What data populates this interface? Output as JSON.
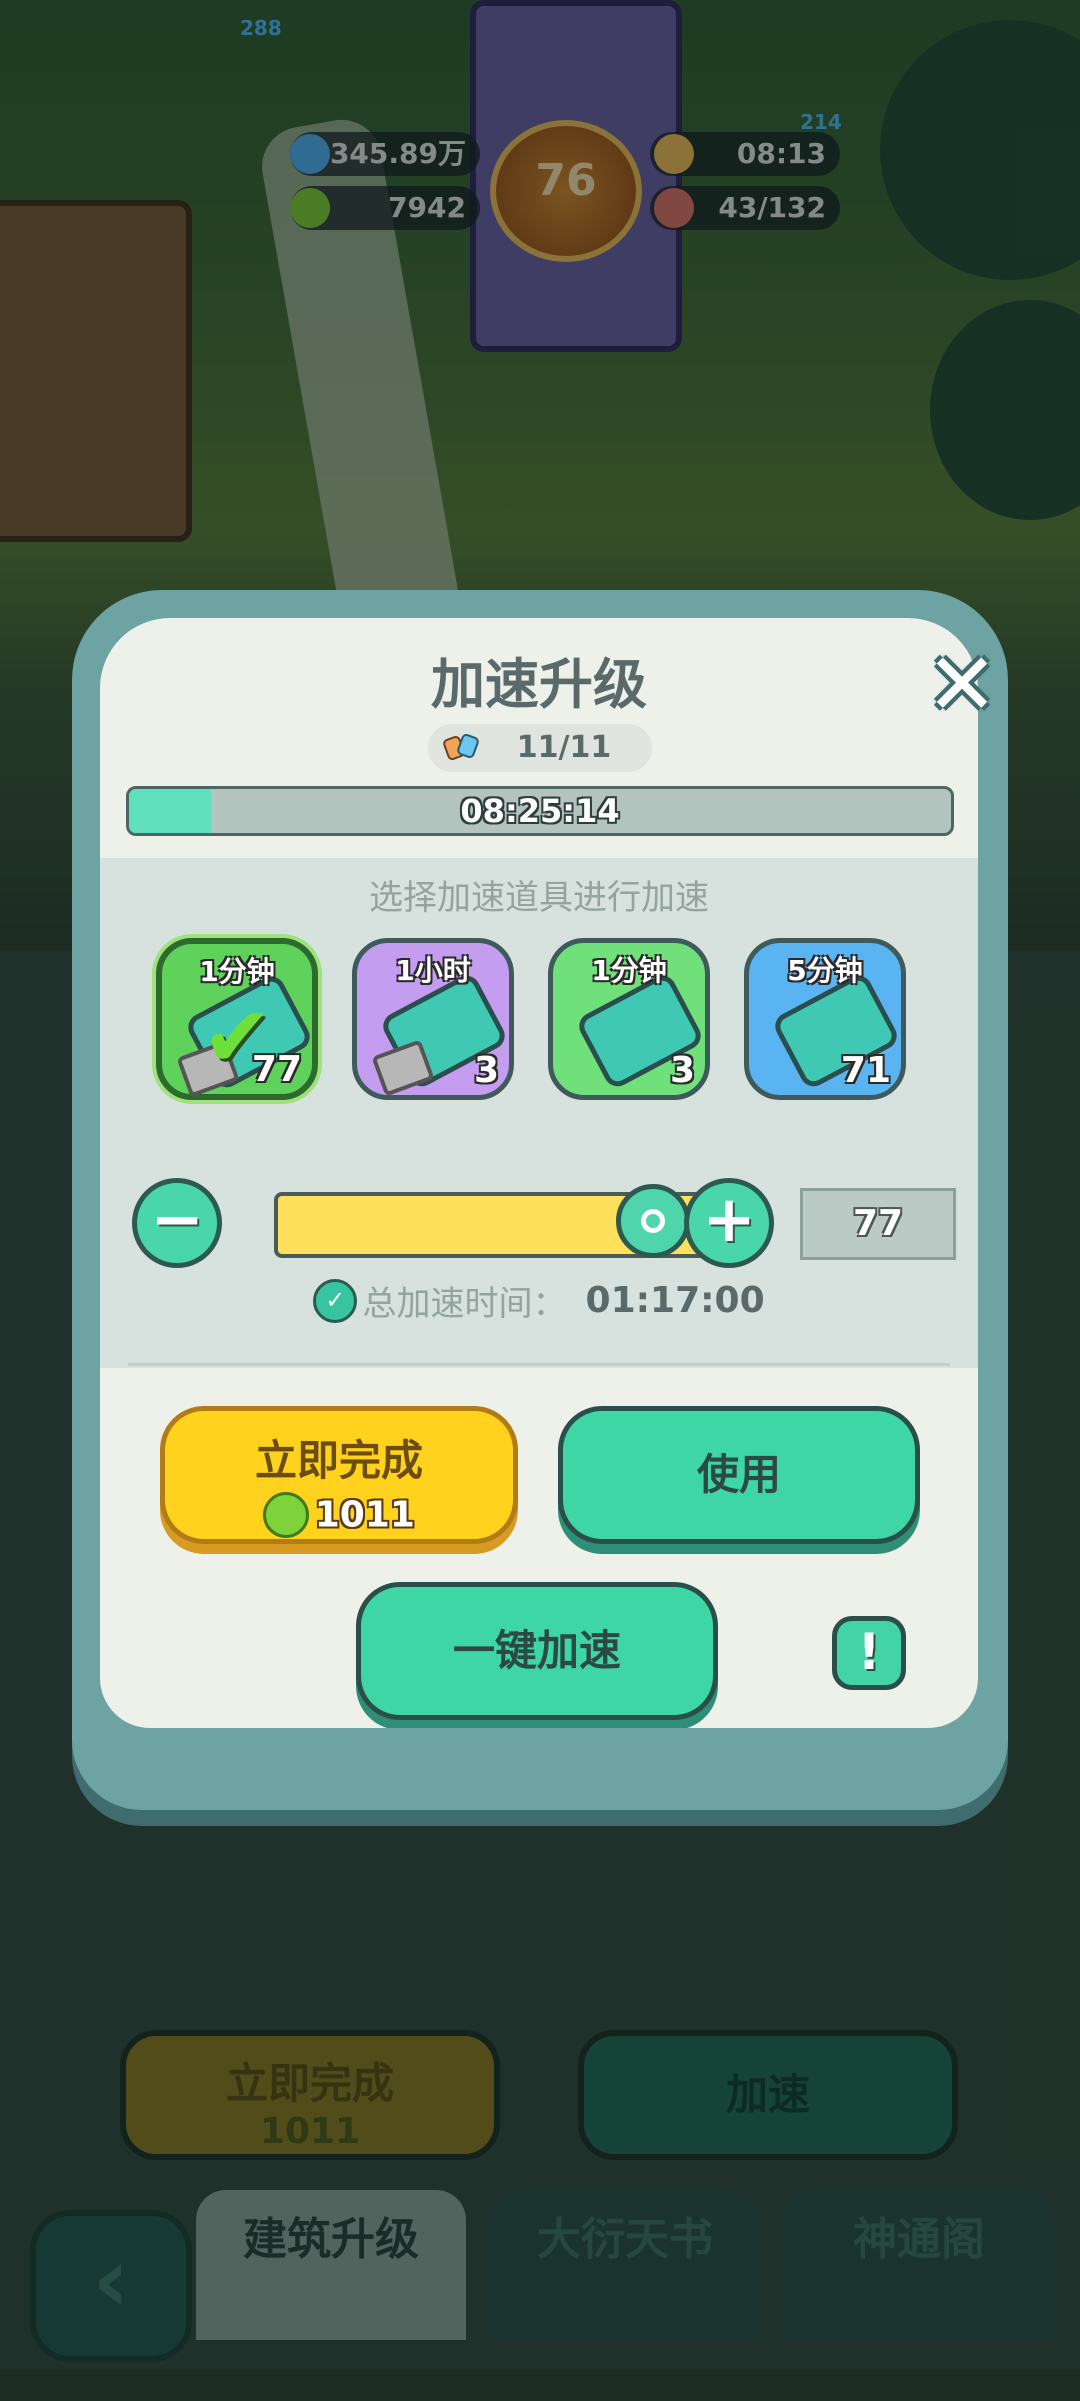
{
  "hud": {
    "gems": "345.89万",
    "jade": "7942",
    "level": "76",
    "timer": "08:13",
    "population": "43/132",
    "small_left": "288",
    "small_right": "214"
  },
  "background": {
    "instant_label": "立即完成",
    "instant_cost": "1011",
    "speedup_label": "加速",
    "tabs": [
      "建筑升级",
      "大衍天书",
      "神通阁"
    ]
  },
  "modal": {
    "title": "加速升级",
    "count": "11/11",
    "timer": "08:25:14",
    "progress_fraction": 0.1,
    "hint": "选择加速道具进行加速",
    "items": [
      {
        "label": "1分钟",
        "count": "77",
        "color": "#5fd25c",
        "selected": true
      },
      {
        "label": "1小时",
        "count": "3",
        "color": "#c49cf0",
        "selected": false
      },
      {
        "label": "1分钟",
        "count": "3",
        "color": "#6fe07a",
        "selected": false
      },
      {
        "label": "5分钟",
        "count": "71",
        "color": "#5ab4f2",
        "selected": false
      }
    ],
    "quantity": "77",
    "slider_fraction": 1.0,
    "total_label": "总加速时间：",
    "total_value": "01:17:00",
    "instant_label": "立即完成",
    "instant_cost": "1011",
    "use_label": "使用",
    "one_click_label": "一键加速",
    "info_symbol": "!",
    "close_symbol": "✕"
  }
}
